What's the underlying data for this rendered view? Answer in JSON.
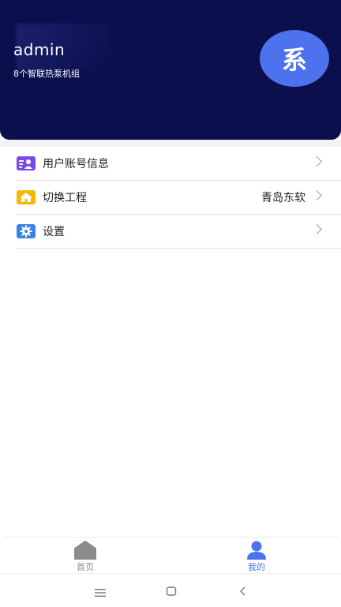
{
  "header": {
    "username": "admin",
    "subtitle": "8个智联热泵机组",
    "avatar_text": "系",
    "background_color": "#0b0f4e",
    "avatar_color": "#4d72ee"
  },
  "menu": [
    {
      "label": "用户账号信息",
      "value": "",
      "icon": "user-card-icon",
      "icon_color": "#7a4be0"
    },
    {
      "label": "切换工程",
      "value": "青岛东软",
      "icon": "home-icon",
      "icon_color": "#f5b800"
    },
    {
      "label": "设置",
      "value": "",
      "icon": "gear-icon",
      "icon_color": "#3b82e6"
    }
  ],
  "tabbar": {
    "tabs": [
      {
        "label": "首页",
        "icon": "home-icon",
        "active": false,
        "color": "#9a9a9a"
      },
      {
        "label": "我的",
        "icon": "profile-icon",
        "active": true,
        "color": "#4d72ee"
      }
    ]
  },
  "system_nav": {
    "buttons": [
      "menu-icon",
      "home-square-icon",
      "back-icon"
    ]
  }
}
